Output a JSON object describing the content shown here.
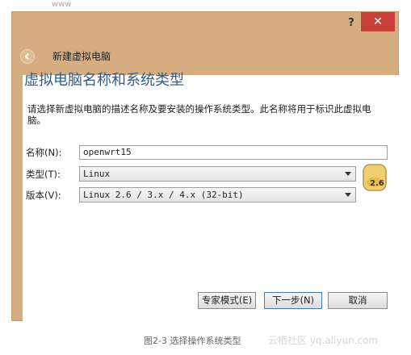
{
  "header": {
    "top_text": "www",
    "help": "?",
    "close": "✕",
    "wizard_title": "新建虚拟电脑"
  },
  "panel": {
    "heading": "虚拟电脑名称和系统类型",
    "description": "请选择新虚拟电脑的描述名称及要安装的操作系统类型。此名称将用于标识此虚拟电脑。"
  },
  "form": {
    "name_label": "名称(N):",
    "name_value": "openwrt15",
    "type_label": "类型(T):",
    "type_value": "Linux",
    "version_label": "版本(V):",
    "version_value": "Linux 2.6 / 3.x / 4.x (32-bit)",
    "os_badge": "2.6"
  },
  "buttons": {
    "expert": "专家模式(E)",
    "next": "下一步(N)",
    "cancel": "取消"
  },
  "caption": {
    "text": "图2-3 选择操作系统类型",
    "watermark": "云栖社区 yq.aliyun.com"
  },
  "colors": {
    "titlebar": "#d6ad80",
    "close": "#c8403a",
    "heading": "#2f5c8a",
    "badge": "#f0cf72"
  },
  "icons": {
    "back": "arrow-left-icon",
    "help": "question-icon",
    "close": "close-icon",
    "os": "linux-os-icon"
  }
}
